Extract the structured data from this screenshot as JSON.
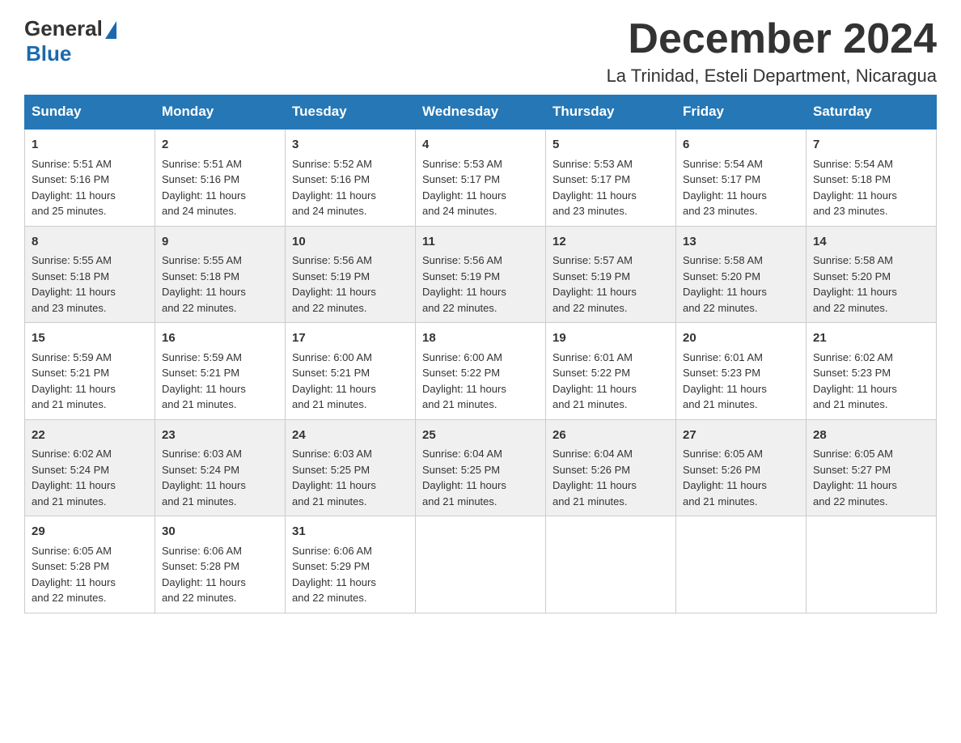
{
  "header": {
    "logo_general": "General",
    "logo_blue": "Blue",
    "month_title": "December 2024",
    "location": "La Trinidad, Esteli Department, Nicaragua"
  },
  "days_of_week": [
    "Sunday",
    "Monday",
    "Tuesday",
    "Wednesday",
    "Thursday",
    "Friday",
    "Saturday"
  ],
  "weeks": [
    [
      {
        "day": "1",
        "sunrise": "5:51 AM",
        "sunset": "5:16 PM",
        "daylight": "11 hours and 25 minutes."
      },
      {
        "day": "2",
        "sunrise": "5:51 AM",
        "sunset": "5:16 PM",
        "daylight": "11 hours and 24 minutes."
      },
      {
        "day": "3",
        "sunrise": "5:52 AM",
        "sunset": "5:16 PM",
        "daylight": "11 hours and 24 minutes."
      },
      {
        "day": "4",
        "sunrise": "5:53 AM",
        "sunset": "5:17 PM",
        "daylight": "11 hours and 24 minutes."
      },
      {
        "day": "5",
        "sunrise": "5:53 AM",
        "sunset": "5:17 PM",
        "daylight": "11 hours and 23 minutes."
      },
      {
        "day": "6",
        "sunrise": "5:54 AM",
        "sunset": "5:17 PM",
        "daylight": "11 hours and 23 minutes."
      },
      {
        "day": "7",
        "sunrise": "5:54 AM",
        "sunset": "5:18 PM",
        "daylight": "11 hours and 23 minutes."
      }
    ],
    [
      {
        "day": "8",
        "sunrise": "5:55 AM",
        "sunset": "5:18 PM",
        "daylight": "11 hours and 23 minutes."
      },
      {
        "day": "9",
        "sunrise": "5:55 AM",
        "sunset": "5:18 PM",
        "daylight": "11 hours and 22 minutes."
      },
      {
        "day": "10",
        "sunrise": "5:56 AM",
        "sunset": "5:19 PM",
        "daylight": "11 hours and 22 minutes."
      },
      {
        "day": "11",
        "sunrise": "5:56 AM",
        "sunset": "5:19 PM",
        "daylight": "11 hours and 22 minutes."
      },
      {
        "day": "12",
        "sunrise": "5:57 AM",
        "sunset": "5:19 PM",
        "daylight": "11 hours and 22 minutes."
      },
      {
        "day": "13",
        "sunrise": "5:58 AM",
        "sunset": "5:20 PM",
        "daylight": "11 hours and 22 minutes."
      },
      {
        "day": "14",
        "sunrise": "5:58 AM",
        "sunset": "5:20 PM",
        "daylight": "11 hours and 22 minutes."
      }
    ],
    [
      {
        "day": "15",
        "sunrise": "5:59 AM",
        "sunset": "5:21 PM",
        "daylight": "11 hours and 21 minutes."
      },
      {
        "day": "16",
        "sunrise": "5:59 AM",
        "sunset": "5:21 PM",
        "daylight": "11 hours and 21 minutes."
      },
      {
        "day": "17",
        "sunrise": "6:00 AM",
        "sunset": "5:21 PM",
        "daylight": "11 hours and 21 minutes."
      },
      {
        "day": "18",
        "sunrise": "6:00 AM",
        "sunset": "5:22 PM",
        "daylight": "11 hours and 21 minutes."
      },
      {
        "day": "19",
        "sunrise": "6:01 AM",
        "sunset": "5:22 PM",
        "daylight": "11 hours and 21 minutes."
      },
      {
        "day": "20",
        "sunrise": "6:01 AM",
        "sunset": "5:23 PM",
        "daylight": "11 hours and 21 minutes."
      },
      {
        "day": "21",
        "sunrise": "6:02 AM",
        "sunset": "5:23 PM",
        "daylight": "11 hours and 21 minutes."
      }
    ],
    [
      {
        "day": "22",
        "sunrise": "6:02 AM",
        "sunset": "5:24 PM",
        "daylight": "11 hours and 21 minutes."
      },
      {
        "day": "23",
        "sunrise": "6:03 AM",
        "sunset": "5:24 PM",
        "daylight": "11 hours and 21 minutes."
      },
      {
        "day": "24",
        "sunrise": "6:03 AM",
        "sunset": "5:25 PM",
        "daylight": "11 hours and 21 minutes."
      },
      {
        "day": "25",
        "sunrise": "6:04 AM",
        "sunset": "5:25 PM",
        "daylight": "11 hours and 21 minutes."
      },
      {
        "day": "26",
        "sunrise": "6:04 AM",
        "sunset": "5:26 PM",
        "daylight": "11 hours and 21 minutes."
      },
      {
        "day": "27",
        "sunrise": "6:05 AM",
        "sunset": "5:26 PM",
        "daylight": "11 hours and 21 minutes."
      },
      {
        "day": "28",
        "sunrise": "6:05 AM",
        "sunset": "5:27 PM",
        "daylight": "11 hours and 22 minutes."
      }
    ],
    [
      {
        "day": "29",
        "sunrise": "6:05 AM",
        "sunset": "5:28 PM",
        "daylight": "11 hours and 22 minutes."
      },
      {
        "day": "30",
        "sunrise": "6:06 AM",
        "sunset": "5:28 PM",
        "daylight": "11 hours and 22 minutes."
      },
      {
        "day": "31",
        "sunrise": "6:06 AM",
        "sunset": "5:29 PM",
        "daylight": "11 hours and 22 minutes."
      },
      null,
      null,
      null,
      null
    ]
  ]
}
